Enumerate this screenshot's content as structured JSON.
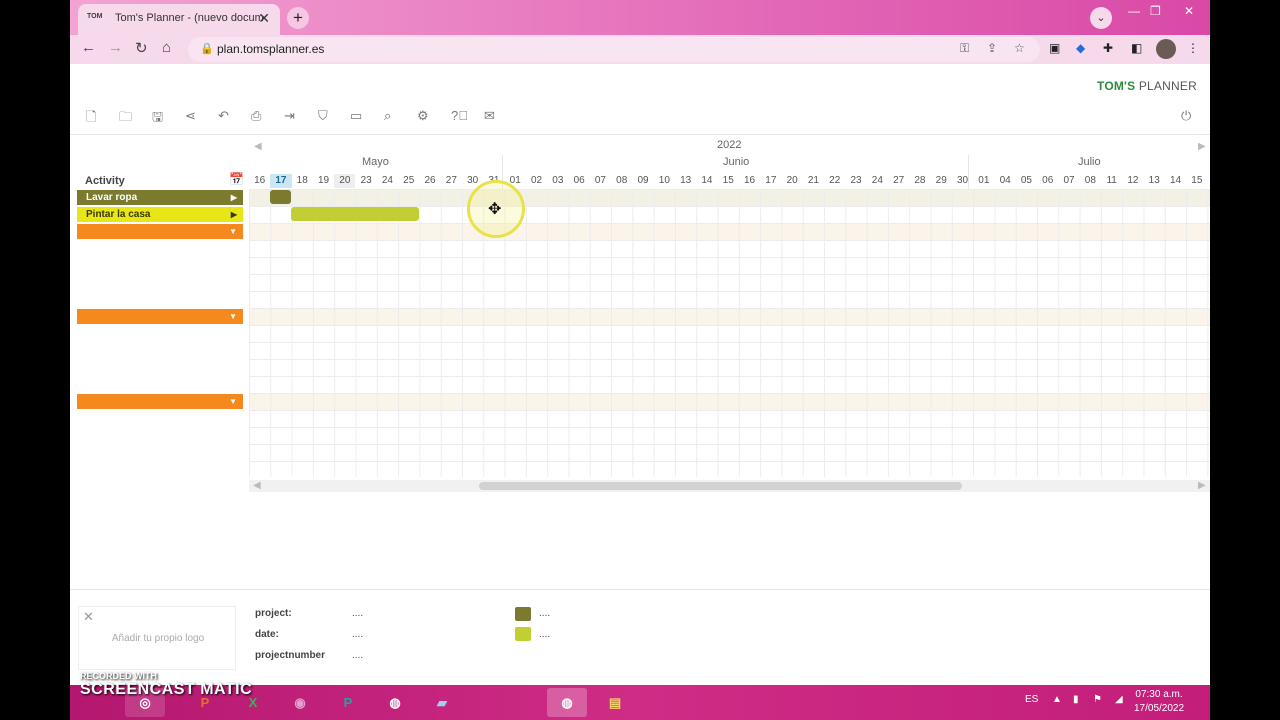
{
  "browser": {
    "tab_title": "Tom's Planner - (nuevo documen",
    "tab_favicon": "TOM",
    "url": "plan.tomsplanner.es"
  },
  "app": {
    "brand_bold": "TOM'S",
    "brand_rest": " PLANNER",
    "toolbar_icons": [
      "new-doc-icon",
      "folder-icon",
      "save-icon",
      "share-icon",
      "undo-icon",
      "print-icon",
      "import-icon",
      "filter-icon",
      "view-icon",
      "search-icon",
      "gear-icon",
      "help-icon",
      "mail-icon"
    ]
  },
  "gantt": {
    "year": "2022",
    "months": [
      "Mayo",
      "Junio",
      "Julio"
    ],
    "days": [
      "16",
      "17",
      "18",
      "19",
      "20",
      "23",
      "24",
      "25",
      "26",
      "27",
      "30",
      "31",
      "01",
      "02",
      "03",
      "06",
      "07",
      "08",
      "09",
      "10",
      "13",
      "14",
      "15",
      "16",
      "17",
      "20",
      "21",
      "22",
      "23",
      "24",
      "27",
      "28",
      "29",
      "30",
      "01",
      "04",
      "05",
      "06",
      "07",
      "08",
      "11",
      "12",
      "13",
      "14",
      "15"
    ],
    "today_index": 1,
    "activity_header": "Activity",
    "activities": [
      {
        "label": "Lavar ropa",
        "color": "#7b7a2f",
        "text_color": "#ffffff"
      },
      {
        "label": "Pintar la casa",
        "color": "#e8e616",
        "text_color": "#3a3a00"
      },
      {
        "label": "",
        "color": "#f5891e",
        "text_color": "#ffffff"
      },
      {
        "label": "",
        "color": "#f5891e",
        "text_color": "#ffffff"
      },
      {
        "label": "",
        "color": "#f5891e",
        "text_color": "#ffffff"
      }
    ]
  },
  "footer": {
    "logo_text": "Añadir tu propio logo",
    "fields": [
      {
        "label": "project:",
        "value": "...."
      },
      {
        "label": "date:",
        "value": "...."
      },
      {
        "label": "projectnumber",
        "value": "...."
      }
    ],
    "legend": [
      {
        "color": "#7b7a2f",
        "value": "...."
      },
      {
        "color": "#c2cf34",
        "value": "...."
      }
    ]
  },
  "taskbar": {
    "language": "ES",
    "time": "07:30 a.m.",
    "date": "17/05/2022"
  },
  "watermark": {
    "line1": "RECORDED WITH",
    "line2": "SCREENCAST",
    "line3": "MATIC"
  }
}
